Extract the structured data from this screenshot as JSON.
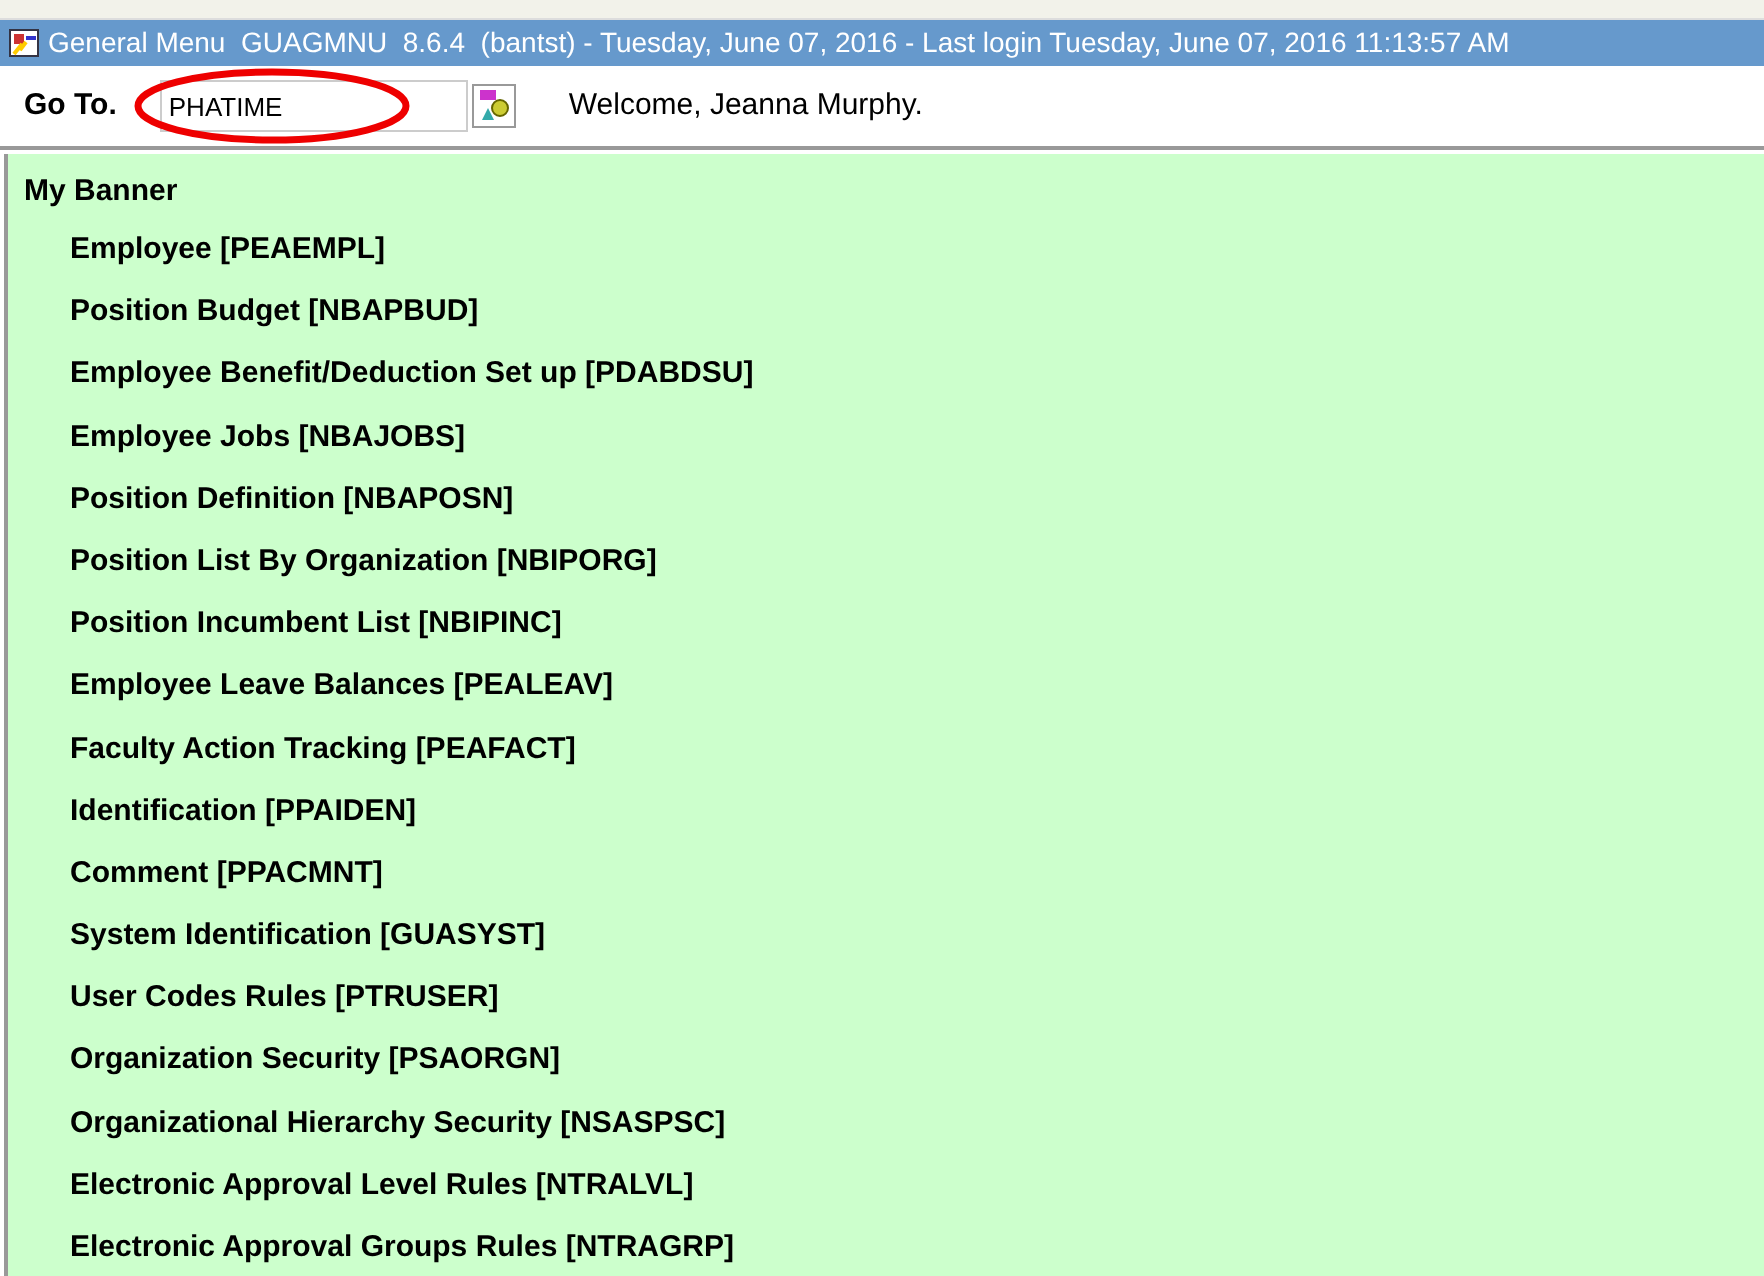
{
  "window": {
    "title": "General Menu  GUAGMNU  8.6.4  (bantst) - Tuesday, June 07, 2016 - Last login Tuesday, June 07, 2016 11:13:57 AM"
  },
  "goto": {
    "label": "Go To.",
    "value": "PHATIME"
  },
  "welcome": "Welcome, Jeanna Murphy.",
  "menu": {
    "title": "My Banner",
    "items": [
      "Employee [PEAEMPL]",
      "Position Budget [NBAPBUD]",
      "Employee Benefit/Deduction Set up [PDABDSU]",
      "Employee Jobs [NBAJOBS]",
      "Position Definition [NBAPOSN]",
      "Position List By Organization [NBIPORG]",
      "Position Incumbent List [NBIPINC]",
      "Employee Leave Balances [PEALEAV]",
      "Faculty Action Tracking [PEAFACT]",
      "Identification [PPAIDEN]",
      "Comment [PPACMNT]",
      "System Identification [GUASYST]",
      "User Codes Rules [PTRUSER]",
      "Organization Security [PSAORGN]",
      "Organizational Hierarchy Security [NSASPSC]",
      "Electronic Approval Level Rules [NTRALVL]",
      "Electronic Approval Groups Rules [NTRAGRP]"
    ]
  }
}
